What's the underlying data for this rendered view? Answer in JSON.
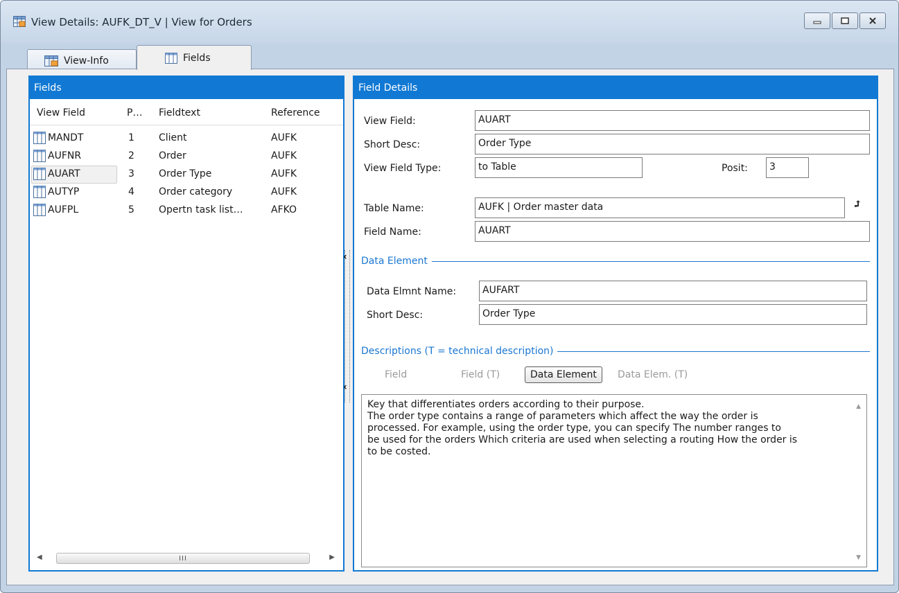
{
  "window": {
    "title": "View Details: AUFK_DT_V | View for Orders"
  },
  "tabs": [
    {
      "label": "View-Info",
      "active": false
    },
    {
      "label": "Fields",
      "active": true
    }
  ],
  "fields_panel": {
    "header": "Fields",
    "columns": [
      "View Field",
      "P…",
      "Fieldtext",
      "Reference"
    ],
    "rows": [
      {
        "view_field": "MANDT",
        "pos": "1",
        "fieldtext": "Client",
        "reference": "AUFK"
      },
      {
        "view_field": "AUFNR",
        "pos": "2",
        "fieldtext": "Order",
        "reference": "AUFK"
      },
      {
        "view_field": "AUART",
        "pos": "3",
        "fieldtext": "Order Type",
        "reference": "AUFK"
      },
      {
        "view_field": "AUTYP",
        "pos": "4",
        "fieldtext": "Order category",
        "reference": "AUFK"
      },
      {
        "view_field": "AUFPL",
        "pos": "5",
        "fieldtext": "Opertn task list…",
        "reference": "AFKO"
      }
    ],
    "selected_row": 2,
    "scroll_thumb_text": "III"
  },
  "details_panel": {
    "header": "Field Details",
    "view_field_label": "View Field:",
    "view_field_value": "AUART",
    "short_desc_label": "Short Desc:",
    "short_desc_value": "Order Type",
    "view_field_type_label": "View Field Type:",
    "view_field_type_value": "to Table",
    "posit_label": "Posit:",
    "posit_value": "3",
    "table_name_label": "Table Name:",
    "table_name_value": "AUFK | Order master data",
    "field_name_label": "Field Name:",
    "field_name_value": "AUART",
    "data_element": {
      "title": "Data Element",
      "name_label": "Data Elmnt Name:",
      "name_value": "AUFART",
      "short_desc_label": "Short Desc:",
      "short_desc_value": "Order Type"
    },
    "descriptions": {
      "title": "Descriptions   (T = technical description)",
      "tabs": [
        "Field",
        "Field (T)",
        "Data Element",
        "Data Elem. (T)"
      ],
      "active_tab": "Data Element",
      "text": "Key that differentiates orders according to their purpose.\nThe order type contains a range of parameters which affect the way the order is\nprocessed. For example, using the order type, you can specify The number ranges to\nbe used for the orders Which criteria are used when selecting a routing How the order is\nto be costed."
    }
  },
  "icons": [
    "table-grid-icon",
    "minimize-icon",
    "maximize-icon",
    "close-icon",
    "expand-arrow-icon",
    "splitter-arrow-icon"
  ]
}
